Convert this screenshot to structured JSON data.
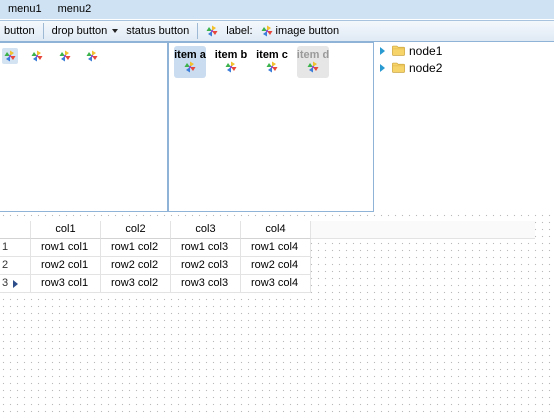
{
  "menubar": {
    "items": [
      "menu1",
      "menu2"
    ]
  },
  "toolbar": {
    "button": "button",
    "drop_button": "drop button",
    "status_button": "status button",
    "label": "label:",
    "image_button": "image button"
  },
  "items_pane": {
    "items": [
      "item a",
      "item b",
      "item c",
      "item d"
    ]
  },
  "tree": {
    "nodes": [
      "node1",
      "node2"
    ]
  },
  "grid": {
    "columns": [
      "col1",
      "col2",
      "col3",
      "col4"
    ],
    "rows": [
      {
        "num": "1",
        "cells": [
          "row1 col1",
          "row1 col2",
          "row1 col3",
          "row1 col4"
        ]
      },
      {
        "num": "2",
        "cells": [
          "row2 col1",
          "row2 col2",
          "row2 col3",
          "row2 col4"
        ]
      },
      {
        "num": "3",
        "cells": [
          "row3 col1",
          "row3 col2",
          "row3 col3",
          "row3 col4"
        ]
      }
    ]
  },
  "colors": {
    "menubar": "#cfe2f3",
    "border": "#8fb3d7",
    "selected": "#c9dcf0",
    "tree_arrow": "#2a9bd1"
  }
}
